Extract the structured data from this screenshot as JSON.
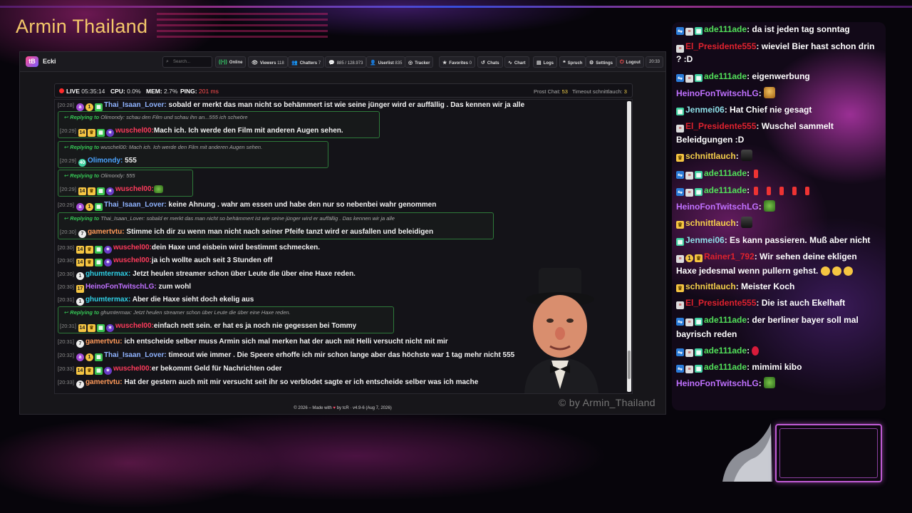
{
  "brand": "Armin Thailand",
  "nav": {
    "name": "Ecki",
    "search_placeholder": "Search...",
    "online": "Online",
    "viewers_label": "Viewers",
    "viewers": "118",
    "chatters_label": "Chatters",
    "chatters": "7",
    "messages": "885 / 128.973",
    "userlist_label": "Userlist",
    "userlist": "835",
    "tracker": "Tracker",
    "favorites_label": "Favorites",
    "favorites": "0",
    "chats": "Chats",
    "chart": "Chart",
    "logs": "Logs",
    "spruch": "Spruch",
    "settings": "Settings",
    "logout": "Logout",
    "time": "20:33"
  },
  "status": {
    "live": "LIVE",
    "live_time": "05:35:14",
    "cpu_label": "CPU:",
    "cpu": "0.0%",
    "mem_label": "MEM:",
    "mem": "2.7%",
    "ping_label": "PING:",
    "ping": "201 ms",
    "prost_label": "Prost Chat:",
    "prost": "53",
    "timeout_label": "Timeout schnittlauch:",
    "timeout": "3"
  },
  "messages": [
    {
      "ts": "[20:28]",
      "user": "Thai_Isaan_Lover:",
      "color": "#8fb3ff",
      "text": "sobald er merkt das man nicht so behämmert ist wie seine jünger wird er auffällig . Das kennen wir ja alle"
    },
    {
      "reply_label": "Replying to",
      "reply_to": "Olimondy: schau den Film und schau ihn an...555 ich schwöre",
      "ts": "[20:29]",
      "user": "wuschel00:",
      "color": "#ff3b5c",
      "text": "Mach ich. Ich werde den Film mit anderen Augen sehen."
    },
    {
      "reply_label": "Replying to",
      "reply_to": "wuschel00: Mach ich. Ich werde den Film mit anderen Augen sehen.",
      "ts": "[20:29]",
      "user": "Olimondy:",
      "color": "#4aa3ff",
      "text": "555"
    },
    {
      "reply_label": "Replying to",
      "reply_to": "Olimondy: 555",
      "ts": "[20:29]",
      "user": "wuschel00:",
      "color": "#ff3b5c",
      "text": ""
    },
    {
      "ts": "[20:29]",
      "user": "Thai_Isaan_Lover:",
      "color": "#8fb3ff",
      "text": "keine Ahnung . wahr am essen und habe den nur so nebenbei wahr genommen"
    },
    {
      "reply_label": "Replying to",
      "reply_to": "Thai_Isaan_Lover: sobald er merkt das man nicht so behämmert ist wie seine jünger wird er auffällig . Das kennen wir ja alle",
      "ts": "[20:30]",
      "user": "gamertvtu:",
      "color": "#ff9a5a",
      "text": "Stimme ich dir zu wenn man nicht nach seiner Pfeife tanzt wird er ausfallen und beleidigen"
    },
    {
      "ts": "[20:30]",
      "user": "wuschel00:",
      "color": "#ff3b5c",
      "text": "dein Haxe und eisbein wird bestimmt schmecken."
    },
    {
      "ts": "[20:30]",
      "user": "wuschel00:",
      "color": "#ff3b5c",
      "text": "ja ich wollte auch seit 3 Stunden off"
    },
    {
      "ts": "[20:30]",
      "user": "ghumtermax:",
      "color": "#2fd0e6",
      "text": "Jetzt heulen streamer schon über Leute die über eine Haxe reden."
    },
    {
      "ts": "[20:30]",
      "user": "HeinoFonTwitschLG:",
      "color": "#c071ff",
      "text": "zum wohl"
    },
    {
      "ts": "[20:31]",
      "user": "ghumtermax:",
      "color": "#2fd0e6",
      "text": "Aber die Haxe sieht doch ekelig aus"
    },
    {
      "reply_label": "Replying to",
      "reply_to": "ghumtermax: Jetzt heulen streamer schon über Leute die über eine Haxe reden.",
      "ts": "[20:31]",
      "user": "wuschel00:",
      "color": "#ff3b5c",
      "text": "einfach nett sein. er hat es ja noch nie gegessen bei Tommy"
    },
    {
      "ts": "[20:31]",
      "user": "gamertvtu:",
      "color": "#ff9a5a",
      "text": "ich entscheide selber muss Armin sich mal merken hat der auch mit Helli versucht nicht mit mir"
    },
    {
      "ts": "[20:32]",
      "user": "Thai_Isaan_Lover:",
      "color": "#8fb3ff",
      "text": "timeout wie immer . Die Speere erhoffe ich mir schon lange aber das höchste war 1 tag mehr nicht 555"
    },
    {
      "ts": "[20:33]",
      "user": "wuschel00:",
      "color": "#ff3b5c",
      "text": "er bekommt Geld für Nachrichten oder"
    },
    {
      "ts": "[20:33]",
      "user": "gamertvtu:",
      "color": "#ff9a5a",
      "text": "Hat der gestern auch mit mir versucht seit ihr so verblodet sagte er ich entscheide selber was ich mache"
    }
  ],
  "watermark": "© by Armin_Thailand",
  "footer": {
    "left": "© 2026 – Made with",
    "right": "by tcR · v4.9-6 (Aug 7, 2026)"
  },
  "side_chat": [
    {
      "user": "ade111ade",
      "color": "#52e05a",
      "text": ": da ist jeden tag sonntag"
    },
    {
      "user": "El_Presidente555",
      "color": "#e0222e",
      "text": ": wieviel Bier hast schon drin"
    },
    {
      "text2": "? :D"
    },
    {
      "user": "ade111ade",
      "color": "#52e05a",
      "text": ": eigenwerbung"
    },
    {
      "user": "HeinoFonTwitschLG",
      "color": "#c071ff",
      "text": ":"
    },
    {
      "user": "Jenmei06",
      "color": "#8ee0e8",
      "text": ": Hat Chief nie gesagt"
    },
    {
      "user": "El_Presidente555",
      "color": "#e0222e",
      "text": ": Wuschel sammelt"
    },
    {
      "text2": "Beleidgungen :D"
    },
    {
      "user": "schnittlauch",
      "color": "#f5d04a",
      "text": ":"
    },
    {
      "user": "ade111ade",
      "color": "#52e05a",
      "text": ":"
    },
    {
      "user": "ade111ade",
      "color": "#52e05a",
      "text": ":"
    },
    {
      "user": "HeinoFonTwitschLG",
      "color": "#c071ff",
      "text": ":"
    },
    {
      "user": "schnittlauch",
      "color": "#f5d04a",
      "text": ":"
    },
    {
      "user": "Jenmei06",
      "color": "#8ee0e8",
      "text": ": Es kann passieren. Muß aber nicht"
    },
    {
      "user": "Rainer1_792",
      "color": "#e0222e",
      "text": ": Wir sehen deine ekligen"
    },
    {
      "text2": "Haxe jedesmal wenn pullern gehst."
    },
    {
      "user": "schnittlauch",
      "color": "#f5d04a",
      "text": ": Meister Koch"
    },
    {
      "user": "El_Presidente555",
      "color": "#e0222e",
      "text": ": Die ist auch Ekelhaft"
    },
    {
      "user": "ade111ade",
      "color": "#52e05a",
      "text": ": der berliner bayer soll mal"
    },
    {
      "text2": "bayrisch reden"
    },
    {
      "user": "ade111ade",
      "color": "#52e05a",
      "text": ":"
    },
    {
      "user": "ade111ade",
      "color": "#52e05a",
      "text": ": mimimi kibo"
    },
    {
      "user": "HeinoFonTwitschLG",
      "color": "#c071ff",
      "text": ":"
    }
  ]
}
